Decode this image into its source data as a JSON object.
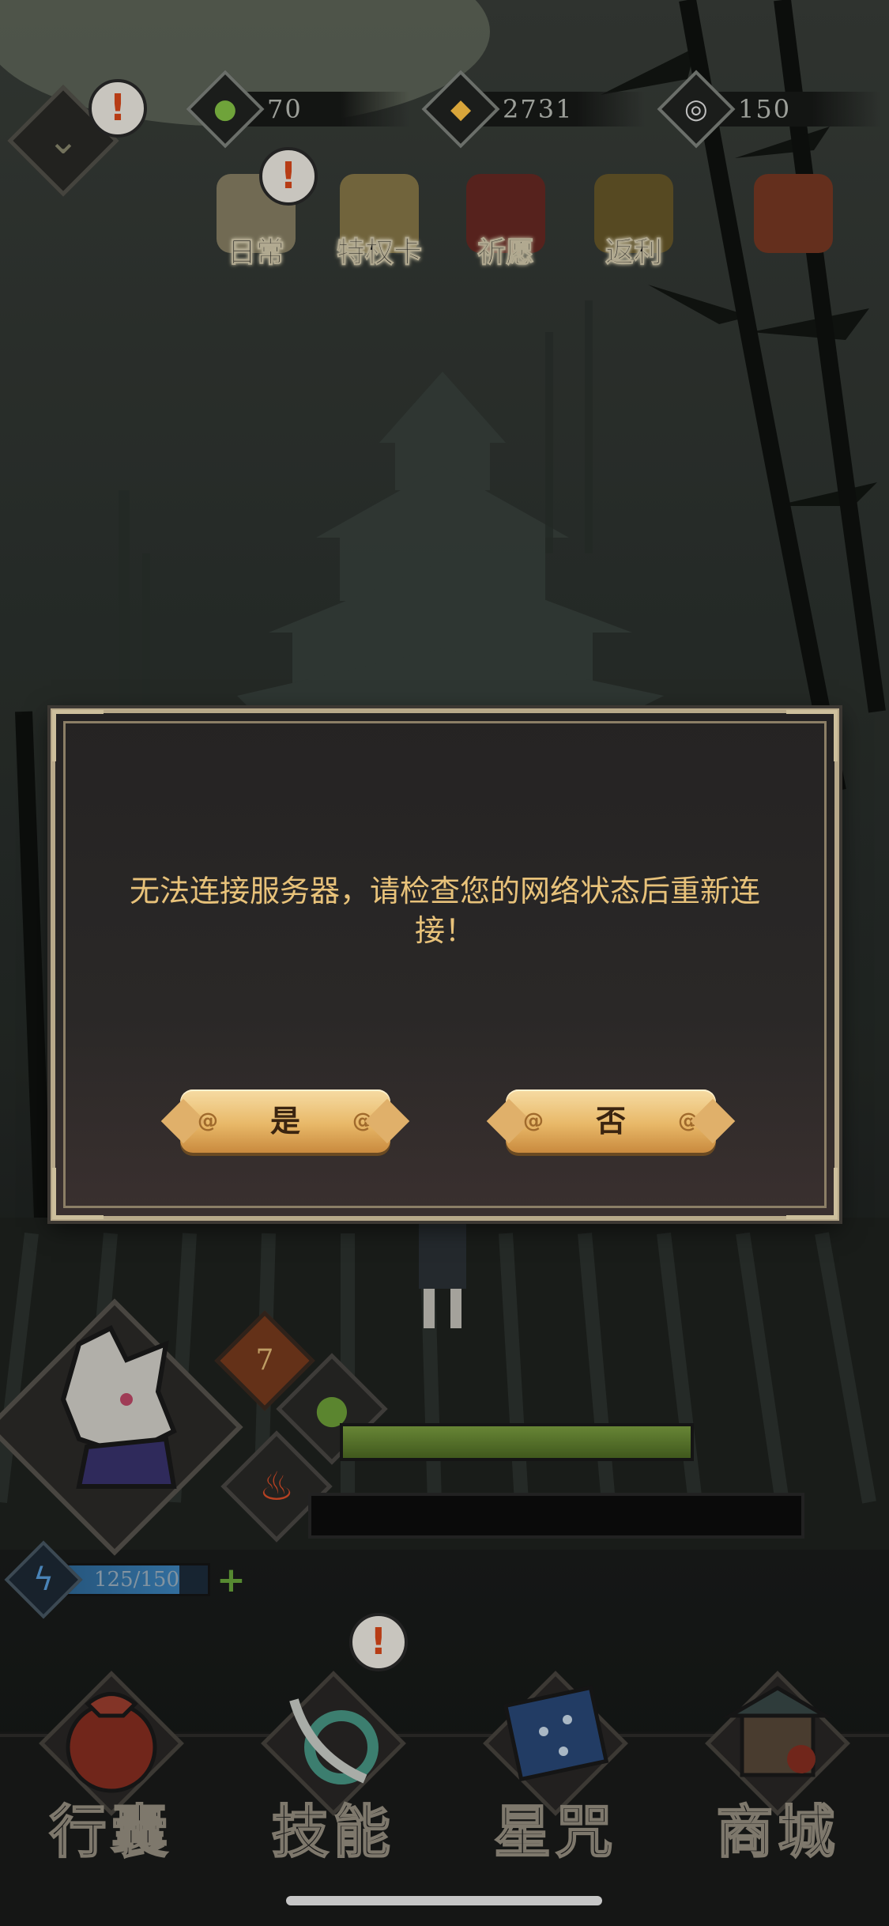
{
  "resources": [
    {
      "name": "jade",
      "icon": "jade-drop-icon",
      "value": "70",
      "color": "#6fa33a"
    },
    {
      "name": "coin",
      "icon": "gold-coin-icon",
      "value": "2731",
      "color": "#d8a53a"
    },
    {
      "name": "token",
      "icon": "silver-token-icon",
      "value": "150",
      "color": "#bfbfbf"
    }
  ],
  "activities": [
    {
      "label": "日常",
      "icon": "scroll-icon",
      "alert": true
    },
    {
      "label": "特权卡",
      "icon": "privilege-card-icon",
      "alert": false
    },
    {
      "label": "祈愿",
      "icon": "torii-gate-icon",
      "alert": false
    },
    {
      "label": "返利",
      "icon": "treasure-chest-icon",
      "alert": false
    },
    {
      "label": "",
      "icon": "gift-box-icon",
      "alert": false
    }
  ],
  "dialog": {
    "message": "无法连接服务器，请检查您的网络状态后重新连接！",
    "confirm_label": "是",
    "cancel_label": "否"
  },
  "player": {
    "level": "7",
    "energy": "125/150",
    "energy_fraction": 0.83,
    "hp_fraction": 1.0
  },
  "nav": [
    {
      "label": "行囊",
      "icon": "pouch-icon"
    },
    {
      "label": "技能",
      "icon": "blade-icon",
      "alert": true
    },
    {
      "label": "星咒",
      "icon": "star-scroll-icon"
    },
    {
      "label": "商城",
      "icon": "shop-icon"
    }
  ],
  "colors": {
    "accent": "#e8c27a",
    "button": "#e8b868",
    "alert": "#e04a1a"
  }
}
